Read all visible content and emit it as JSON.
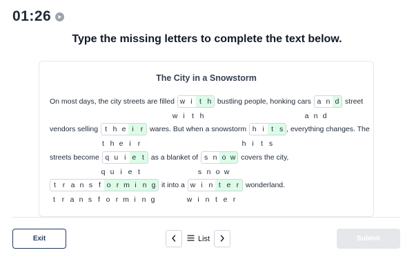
{
  "timer": {
    "time": "01:26",
    "icon": "play-icon"
  },
  "instruction": "Type the missing letters to complete the text below.",
  "passage": {
    "title": "The City in a Snowstorm",
    "lines": [
      {
        "segments": [
          {
            "type": "text",
            "text": "On most days, the city streets are filled"
          },
          {
            "type": "word",
            "letters": [
              "w",
              "i",
              "t",
              "h"
            ],
            "missing": [
              2,
              3
            ]
          },
          {
            "type": "text",
            "text": "bustling people, honking cars"
          },
          {
            "type": "word",
            "letters": [
              "a",
              "n",
              "d"
            ],
            "missing": [
              2
            ]
          },
          {
            "type": "text",
            "text": "street"
          }
        ],
        "hints": [
          "w i t h",
          "a n d"
        ]
      },
      {
        "segments": [
          {
            "type": "text",
            "text": "vendors selling"
          },
          {
            "type": "word",
            "letters": [
              "t",
              "h",
              "e",
              "i",
              "r"
            ],
            "missing": [
              3,
              4
            ]
          },
          {
            "type": "text",
            "text": "wares. But when a snowstorm"
          },
          {
            "type": "word",
            "letters": [
              "h",
              "i",
              "t",
              "s"
            ],
            "missing": [
              2,
              3
            ]
          },
          {
            "type": "text",
            "text": ", everything changes. The"
          }
        ],
        "hints": [
          "t h e i r",
          "h i t s"
        ]
      },
      {
        "segments": [
          {
            "type": "text",
            "text": "streets become"
          },
          {
            "type": "word",
            "letters": [
              "q",
              "u",
              "i",
              "e",
              "t"
            ],
            "missing": [
              3,
              4
            ]
          },
          {
            "type": "text",
            "text": "as a blanket of"
          },
          {
            "type": "word",
            "letters": [
              "s",
              "n",
              "o",
              "w"
            ],
            "missing": [
              2,
              3
            ]
          },
          {
            "type": "text",
            "text": "covers the city,"
          }
        ],
        "hints": [
          "q u i e t",
          "s n o w"
        ]
      },
      {
        "segments": [
          {
            "type": "word",
            "letters": [
              "t",
              "r",
              "a",
              "n",
              "s",
              "f",
              "o",
              "r",
              "m",
              "i",
              "n",
              "g"
            ],
            "missing": [
              6,
              7,
              8,
              9,
              10,
              11
            ]
          },
          {
            "type": "text",
            "text": "it into a"
          },
          {
            "type": "word",
            "letters": [
              "w",
              "i",
              "n",
              "t",
              "e",
              "r"
            ],
            "missing": [
              3,
              4,
              5
            ]
          },
          {
            "type": "text",
            "text": "wonderland."
          }
        ],
        "hints": [
          "t r a n s f o r m i n g",
          "w i n t e r"
        ]
      }
    ]
  },
  "footer": {
    "exit_label": "Exit",
    "prev_icon": "chevron-left-icon",
    "list_icon": "list-icon",
    "list_label": "List",
    "next_icon": "chevron-right-icon",
    "submit_label": "Submit"
  },
  "colors": {
    "missing_fill": "#dcfce7",
    "exit_border": "#1e3a5f",
    "submit_disabled": "#e5e7eb"
  }
}
